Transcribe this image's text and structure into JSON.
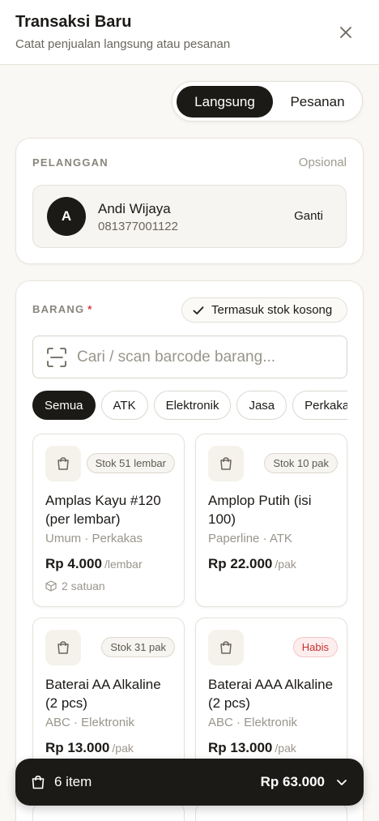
{
  "header": {
    "title": "Transaksi Baru",
    "subtitle": "Catat penjualan langsung atau pesanan"
  },
  "mode": {
    "options": [
      "Langsung",
      "Pesanan"
    ],
    "selected": "Langsung"
  },
  "customer_section": {
    "label": "PELANGGAN",
    "optional_label": "Opsional",
    "customer": {
      "initial": "A",
      "name": "Andi Wijaya",
      "phone": "081377001122",
      "change_label": "Ganti"
    }
  },
  "items_section": {
    "label": "BARANG",
    "required_mark": "*",
    "include_empty_label": "Termasuk stok kosong",
    "search_placeholder": "Cari / scan barcode barang...",
    "categories": [
      "Semua",
      "ATK",
      "Elektronik",
      "Jasa",
      "Perkakas"
    ],
    "active_category": "Semua",
    "products": [
      {
        "stock": "Stok 51 lembar",
        "out_of_stock": false,
        "name": "Amplas Kayu #120 (per lembar)",
        "meta": "Umum · Perkakas",
        "price": "Rp 4.000",
        "unit": "/lembar",
        "units": "2 satuan"
      },
      {
        "stock": "Stok 10 pak",
        "out_of_stock": false,
        "name": "Amplop Putih (isi 100)",
        "meta": "Paperline · ATK",
        "price": "Rp 22.000",
        "unit": "/pak",
        "units": ""
      },
      {
        "stock": "Stok 31 pak",
        "out_of_stock": false,
        "name": "Baterai AA Alkaline (2 pcs)",
        "meta": "ABC · Elektronik",
        "price": "Rp 13.000",
        "unit": "/pak",
        "units": ""
      },
      {
        "stock": "Habis",
        "out_of_stock": true,
        "name": "Baterai AAA Alkaline (2 pcs)",
        "meta": "ABC · Elektronik",
        "price": "Rp 13.000",
        "unit": "/pak",
        "units": ""
      }
    ]
  },
  "cart": {
    "count_label": "6 item",
    "total": "Rp 63.000"
  },
  "icons": {
    "close": "close-icon",
    "check": "check-icon",
    "scan": "barcode-scan-icon",
    "product": "shopping-bag-icon",
    "units": "package-icon",
    "cart": "shopping-bag-icon",
    "expand": "chevron-down-icon"
  },
  "colors": {
    "primary": "#1c1a17",
    "background": "#faf8f4",
    "required": "#d23b3b",
    "out_of_stock": "#c62f2f"
  }
}
